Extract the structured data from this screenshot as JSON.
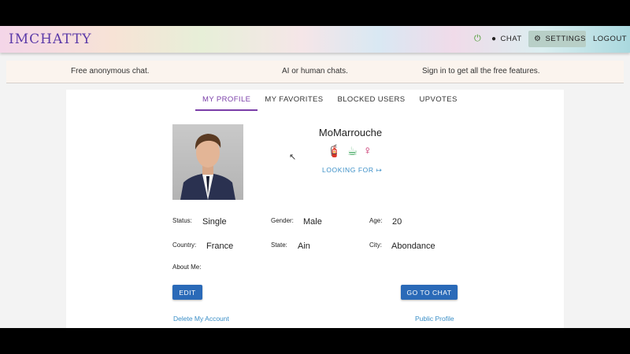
{
  "app": {
    "logo": "IMCHATTY"
  },
  "nav": {
    "plug_icon": "plug-icon",
    "chat_label": "CHAT",
    "settings_label": "SETTINGS",
    "logout_label": "LOGOUT"
  },
  "banner": {
    "item1": "Free anonymous chat.",
    "item2": "AI or human chats.",
    "item3": "Sign in to get all the free features."
  },
  "tabs": [
    {
      "label": "MY PROFILE",
      "active": true
    },
    {
      "label": "MY FAVORITES",
      "active": false
    },
    {
      "label": "BLOCKED USERS",
      "active": false
    },
    {
      "label": "UPVOTES",
      "active": false
    }
  ],
  "profile": {
    "username": "MoMarrouche",
    "looking_for": "LOOKING FOR",
    "icons": [
      "fire-extinguisher-icon",
      "coffee-cup-icon",
      "female-symbol-icon"
    ],
    "fields": {
      "status": {
        "label": "Status:",
        "value": "Single"
      },
      "gender": {
        "label": "Gender:",
        "value": "Male"
      },
      "age": {
        "label": "Age:",
        "value": "20"
      },
      "country": {
        "label": "Country:",
        "value": "France"
      },
      "state": {
        "label": "State:",
        "value": "Ain"
      },
      "city": {
        "label": "City:",
        "value": "Abondance"
      },
      "about": {
        "label": "About Me:",
        "value": ""
      }
    },
    "edit_label": "EDIT",
    "go_chat_label": "GO TO CHAT",
    "delete_label": "Delete My Account",
    "public_label": "Public Profile"
  },
  "colors": {
    "accent": "#7a3ea8",
    "button": "#2a6ab8",
    "link": "#3b8fc7"
  }
}
